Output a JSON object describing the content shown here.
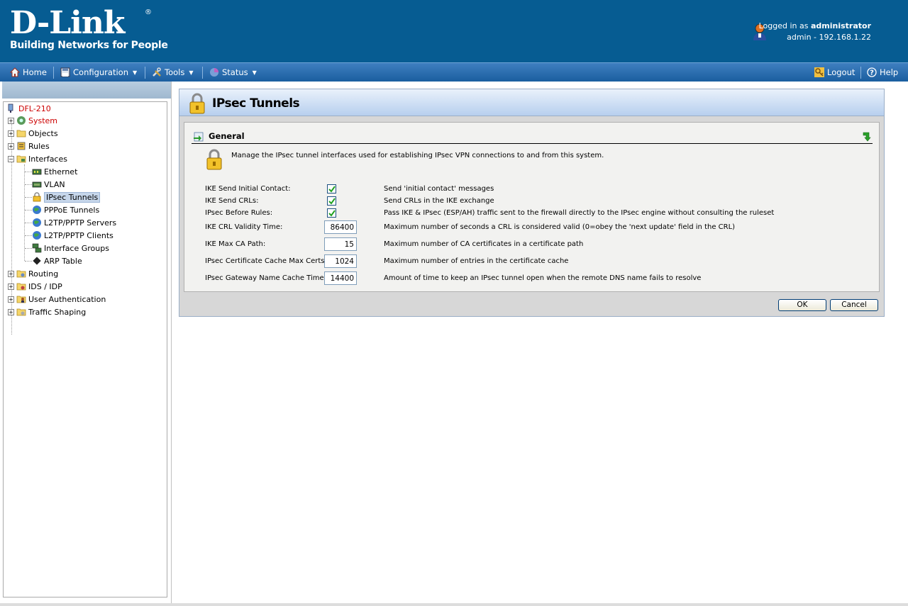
{
  "header": {
    "logo_text": "D-Link",
    "logo_reg": "®",
    "tagline": "Building Networks for People",
    "logged_in_prefix": "Logged in as ",
    "user": "administrator",
    "session": "admin - 192.168.1.22"
  },
  "menu": {
    "home": "Home",
    "configuration": "Configuration",
    "tools": "Tools",
    "status": "Status",
    "logout": "Logout",
    "help": "Help"
  },
  "tree": {
    "root": "DFL-210",
    "system": "System",
    "objects": "Objects",
    "rules": "Rules",
    "interfaces": "Interfaces",
    "ethernet": "Ethernet",
    "vlan": "VLAN",
    "ipsec": "IPsec Tunnels",
    "pppoe": "PPPoE Tunnels",
    "l2tp_servers": "L2TP/PPTP Servers",
    "l2tp_clients": "L2TP/PPTP Clients",
    "interface_groups": "Interface Groups",
    "arp": "ARP Table",
    "routing": "Routing",
    "ids": "IDS / IDP",
    "user_auth": "User Authentication",
    "traffic": "Traffic Shaping"
  },
  "main": {
    "title": "IPsec Tunnels",
    "section": "General",
    "description": "Manage the IPsec tunnel interfaces used for establishing IPsec VPN connections to and from this system.",
    "settings": [
      {
        "label": "IKE Send Initial Contact:",
        "type": "checkbox",
        "checked": true,
        "desc": "Send 'initial contact' messages"
      },
      {
        "label": "IKE Send CRLs:",
        "type": "checkbox",
        "checked": true,
        "desc": "Send CRLs in the IKE exchange"
      },
      {
        "label": "IPsec Before Rules:",
        "type": "checkbox",
        "checked": true,
        "desc": "Pass IKE & IPsec (ESP/AH) traffic sent to the firewall directly to the IPsec engine without consulting the ruleset"
      },
      {
        "label": "IKE CRL Validity Time:",
        "type": "number",
        "value": "86400",
        "desc": "Maximum number of seconds a CRL is considered valid (0=obey the 'next update' field in the CRL)"
      },
      {
        "label": "IKE Max CA Path:",
        "type": "number",
        "value": "15",
        "desc": "Maximum number of CA certificates in a certificate path"
      },
      {
        "label": "IPsec Certificate Cache Max Certs:",
        "type": "number",
        "value": "1024",
        "desc": "Maximum number of entries in the certificate cache"
      },
      {
        "label": "IPsec Gateway Name Cache Time:",
        "type": "number",
        "value": "14400",
        "desc": "Amount of time to keep an IPsec tunnel open when the remote DNS name fails to resolve"
      }
    ],
    "ok": "OK",
    "cancel": "Cancel"
  },
  "colors": {
    "header_bg": "#065c92",
    "menubar": "#2a6aaa",
    "root_red": "#cc0000"
  }
}
